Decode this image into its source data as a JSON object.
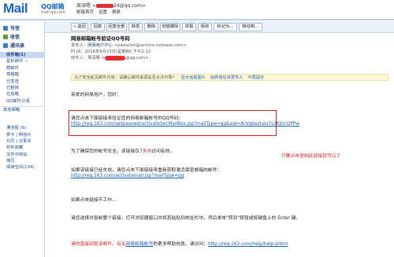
{
  "header": {
    "logo_text": "Mail",
    "logo_cn": "QQ邮箱",
    "logo_url": "mail.qq.com",
    "user_line_prefix": "周深嗯 <",
    "user_line_suffix": "24@qq.com>",
    "user_links": [
      "邮箱首页",
      "设置",
      "换肤"
    ]
  },
  "sidebar": {
    "top_items": [
      {
        "label": "写信",
        "icon": "write-icon",
        "color": "#3b7bd4"
      },
      {
        "label": "收信",
        "icon": "inbox-icon",
        "color": "#5a9e3a"
      },
      {
        "label": "通讯录",
        "icon": "contacts-icon",
        "color": "#3b7bd4"
      }
    ],
    "folders": [
      "收件箱(1)",
      "星标邮件 ☆",
      "群邮件",
      "草稿箱",
      "已发送",
      "已删除",
      "垃圾箱",
      "QQ邮件订阅"
    ],
    "other_head": "其他邮箱",
    "tools": [
      "漂流瓶 (6)",
      "贺卡 | 明信片",
      "日历 | 记事本",
      "附件收藏",
      "文件中转站",
      "简历",
      "阅读空间(134)"
    ]
  },
  "toolbar": {
    "buttons": [
      "« 返回",
      "回复",
      "回复全部",
      "转发",
      "删除",
      "彻底删除",
      "举报",
      "拒收",
      "标记为...",
      "移动到..."
    ]
  },
  "message": {
    "subject": "网易邮箱帐号验证QQ号码",
    "sender_label": "发件人：",
    "sender_name": "网易用户中心",
    "sender_email": "<passport@service.netease.com>",
    "time_label": "时 间：",
    "time_value": "2016年6月23日(星期四) 下午2:12",
    "to_label": "收件人：",
    "to_value": "周深嗯 <",
    "to_suffix": "@qq.com>",
    "notice_text": "为了安全起见邮件内容，请确认邮件来源是否合法可靠？",
    "notice_link1": "显示远程图片",
    "notice_link2": "始终信任该发件人",
    "notice_link3": "不再提示",
    "greeting": "亲爱的网易用户，您好：",
    "instruction": "请您点击下面链接来验证您的网易邮箱帐号的QQ号码：",
    "verify_link": "http://reg.163.com/getpasswd/activateSecMailBox.jsp?mailType=qq&aid=ArVqbezIuIu7s3KJUcOPPw",
    "security_note_a": "为了确保您的帐号安全，该链接仅",
    "security_note_red": "7天内",
    "security_note_b": "访问有效。",
    "expired_note": "如果该链接已经失效，请您点击下面链接来重新获取激活保密邮箱的邮件：",
    "reactivate_link": "http://reg.163.com/activatemail.jsp?mailType=qq",
    "no_click_note": "如果点击链接不工作...",
    "copy_note": "请您选择并复制整个链接，打开浏览器窗口并将其粘贴到地址栏中。然后单击\"转到\"按钮或按键盘上的 Enter 键。",
    "footer_a": "请勿直接回复该邮件，有关",
    "footer_b": "网易邮箱帐号",
    "footer_c": "的更多帮助信息，请访问：",
    "footer_link": "http://reg.163.com/help/help.shtml"
  },
  "annotation": {
    "text": "只要点击复制此链接就可以了",
    "color": "#e02020"
  }
}
